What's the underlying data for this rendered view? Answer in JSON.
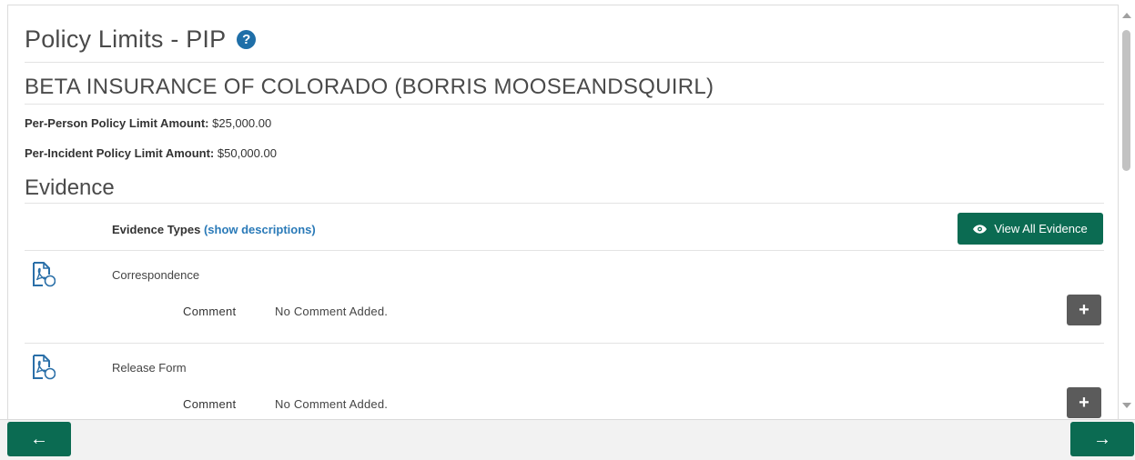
{
  "header": {
    "title": "Policy Limits - PIP",
    "help_icon": "question-circle-icon",
    "help_glyph": "?"
  },
  "insurer": {
    "name": "BETA INSURANCE OF COLORADO (BORRIS MOOSEANDSQUIRL)"
  },
  "limits": {
    "per_person_label": "Per-Person Policy Limit Amount:",
    "per_person_value": "$25,000.00",
    "per_incident_label": "Per-Incident Policy Limit Amount:",
    "per_incident_value": "$50,000.00"
  },
  "evidence": {
    "section_title": "Evidence",
    "types_label": "Evidence Types",
    "show_descriptions_link": "(show descriptions)",
    "view_all_button": "View All Evidence",
    "view_all_icon": "eye-icon",
    "items": [
      {
        "name": "Correspondence",
        "icon": "pdf-document-icon",
        "comment_label": "Comment",
        "comment_value": "No Comment Added.",
        "add_glyph": "+"
      },
      {
        "name": "Release Form",
        "icon": "pdf-document-icon",
        "comment_label": "Comment",
        "comment_value": "No Comment Added.",
        "add_glyph": "+"
      }
    ]
  },
  "footer": {
    "back_glyph": "←",
    "next_glyph": "→"
  },
  "colors": {
    "primary_green": "#0b6b52",
    "link_blue": "#2a7ab8",
    "help_blue": "#1f6fa8",
    "plus_button_gray": "#5b5b5b"
  }
}
